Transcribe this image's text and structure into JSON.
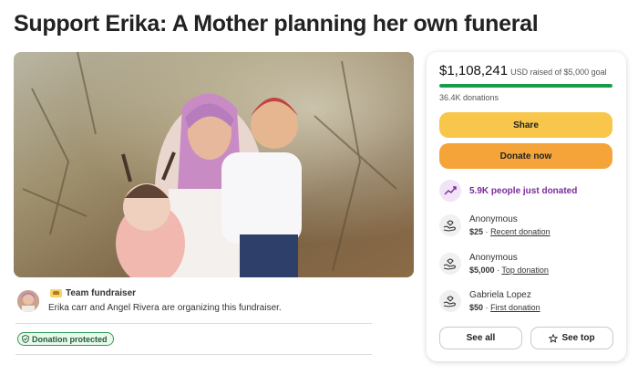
{
  "page": {
    "title": "Support Erika: A Mother planning her own funeral"
  },
  "organizer": {
    "badge_label": "Team fundraiser",
    "text": "Erika carr and Angel Rivera are organizing this fundraiser.",
    "protected_label": "Donation protected"
  },
  "donation_card": {
    "raised_amount": "$1,108,241",
    "raised_label": "USD raised of $5,000 goal",
    "progress_fraction": 1.0,
    "donation_count": "36.4K donations",
    "share_label": "Share",
    "donate_label": "Donate now",
    "just_donated": "5.9K people just donated",
    "donors": [
      {
        "name": "Anonymous",
        "amount": "$25",
        "separator": "·",
        "tag": "Recent donation"
      },
      {
        "name": "Anonymous",
        "amount": "$5,000",
        "separator": "·",
        "tag": "Top donation"
      },
      {
        "name": "Gabriela Lopez",
        "amount": "$50",
        "separator": "·",
        "tag": "First donation"
      }
    ],
    "see_all_label": "See all",
    "see_top_label": "See top"
  },
  "colors": {
    "progress": "#1a9b4c",
    "share_button": "#f7c64a",
    "donate_button": "#f5a43a",
    "just_donated_text": "#7d2a9e",
    "protected_border": "#2f9e55"
  },
  "icons": {
    "team": "team-fundraiser-icon",
    "protected": "shield-check-icon",
    "trend": "trending-up-icon",
    "donor": "donation-hands-icon",
    "star": "star-icon"
  }
}
